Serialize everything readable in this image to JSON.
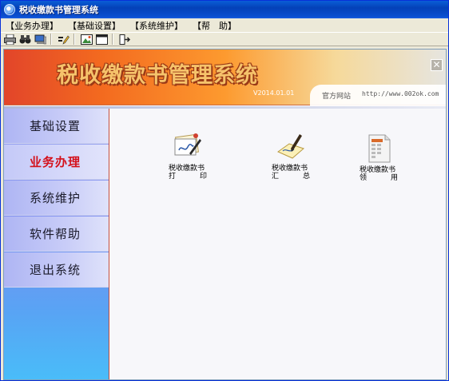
{
  "window": {
    "title": "税收缴款书管理系统"
  },
  "menubar": {
    "items": [
      "【业务办理】",
      "【基础设置】",
      "【系统维护】",
      "【帮　助】"
    ]
  },
  "toolbar": {
    "buttons": [
      "print-icon",
      "binoculars-icon",
      "computer-icon",
      "edit-icon",
      "image-icon",
      "window-icon",
      "exit-icon"
    ]
  },
  "banner": {
    "title": "税收缴款书管理系统",
    "version": "V2014.01.01",
    "site_label": "官方网站",
    "site_url": "http://www.002ok.com",
    "close": "✕"
  },
  "sidebar": {
    "items": [
      {
        "label": "基础设置",
        "active": false
      },
      {
        "label": "业务办理",
        "active": true
      },
      {
        "label": "系统维护",
        "active": false
      },
      {
        "label": "软件帮助",
        "active": false
      },
      {
        "label": "退出系统",
        "active": false
      }
    ]
  },
  "functions": [
    {
      "label_line1": "税收缴款书",
      "label_line2a": "打",
      "label_line2b": "印",
      "icon": "print-document-icon"
    },
    {
      "label_line1": "税收缴款书",
      "label_line2a": "汇",
      "label_line2b": "总",
      "icon": "summary-signature-icon"
    },
    {
      "label_line1": "税收缴款书",
      "label_line2a": "领",
      "label_line2b": "用",
      "icon": "receive-document-icon"
    }
  ],
  "colors": {
    "accent": "#d4101a",
    "banner": "#f36a1f",
    "sidebar": "#7d8ef0"
  }
}
